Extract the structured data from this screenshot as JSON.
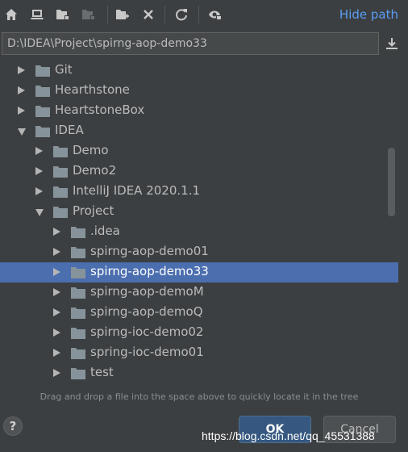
{
  "toolbar": {
    "icons": [
      "home-icon",
      "desktop-icon",
      "new-project-folder-icon",
      "module-folder-icon",
      "new-folder-icon",
      "delete-icon",
      "refresh-icon",
      "show-hidden-icon"
    ],
    "hide_path_label": "Hide path"
  },
  "path": {
    "value": "D:\\IDEA\\Project\\spirng-aop-demo33"
  },
  "tree": {
    "items": [
      {
        "label": "Git",
        "expanded": false,
        "selected": false
      },
      {
        "label": "Hearthstone",
        "expanded": false,
        "selected": false
      },
      {
        "label": "HeartstoneBox",
        "expanded": false,
        "selected": false
      },
      {
        "label": "IDEA",
        "expanded": true,
        "selected": false
      },
      {
        "label": "Demo",
        "expanded": false,
        "selected": false
      },
      {
        "label": "Demo2",
        "expanded": false,
        "selected": false
      },
      {
        "label": "IntelliJ IDEA 2020.1.1",
        "expanded": false,
        "selected": false
      },
      {
        "label": "Project",
        "expanded": true,
        "selected": false
      },
      {
        "label": ".idea",
        "expanded": false,
        "selected": false
      },
      {
        "label": "spirng-aop-demo01",
        "expanded": false,
        "selected": false
      },
      {
        "label": "spirng-aop-demo33",
        "expanded": false,
        "selected": true
      },
      {
        "label": "spirng-aop-demoM",
        "expanded": false,
        "selected": false
      },
      {
        "label": "spirng-aop-demoQ",
        "expanded": false,
        "selected": false
      },
      {
        "label": "spirng-ioc-demo02",
        "expanded": false,
        "selected": false
      },
      {
        "label": "spring-ioc-demo01",
        "expanded": false,
        "selected": false
      },
      {
        "label": "test",
        "expanded": false,
        "selected": false
      }
    ]
  },
  "hint": "Drag and drop a file into the space above to quickly locate it in the tree",
  "buttons": {
    "help": "?",
    "ok": "OK",
    "cancel": "Cancel"
  },
  "watermark": "https://blog.csdn.net/qq_45531388",
  "colors": {
    "background": "#3c3f41",
    "selection": "#4b6eaf",
    "link": "#589df6",
    "folder": "#87939a"
  }
}
